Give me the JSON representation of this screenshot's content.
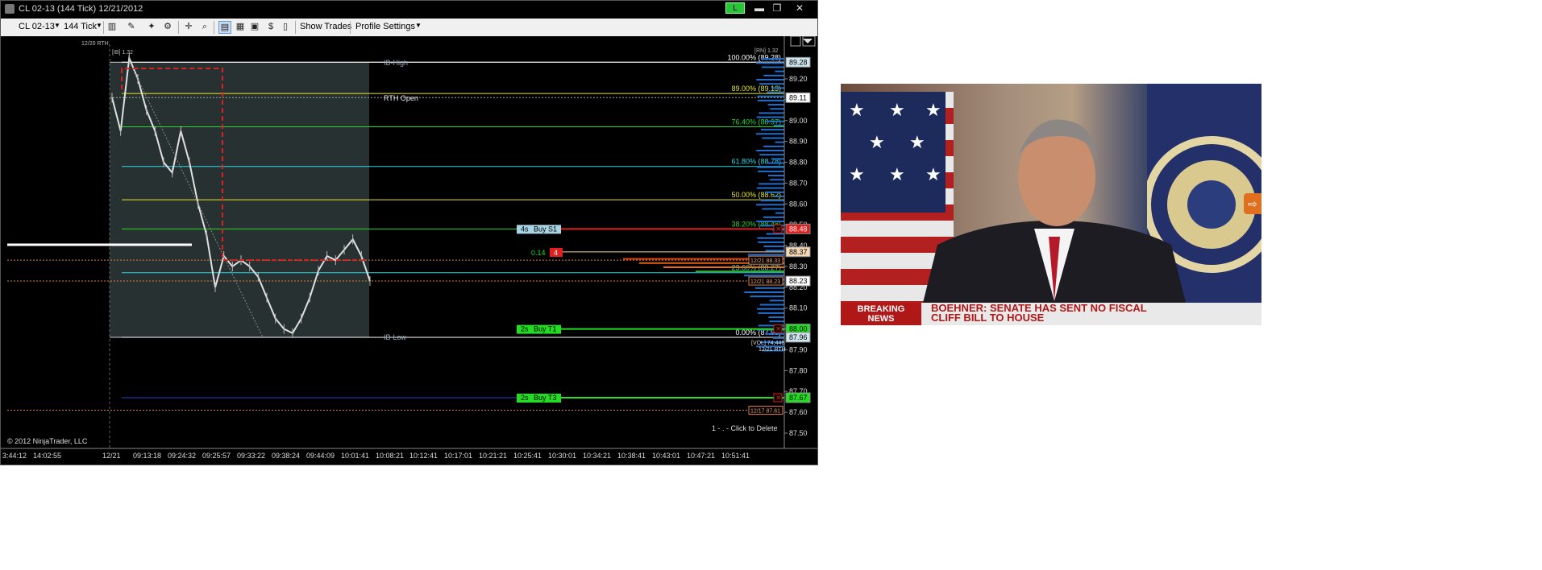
{
  "window": {
    "title": "CL 02-13 (144 Tick)  12/21/2012",
    "connection_badge": "L",
    "min_label": "▬",
    "max_label": "❐",
    "close_label": "✕"
  },
  "toolbar": {
    "instrument": "CL 02-13",
    "interval": "144 Tick",
    "show_trades": "Show Trades",
    "profile_settings": "Profile Settings"
  },
  "chart": {
    "header_label": "12/20 RTH",
    "ib_label": "[IB] 1.32",
    "right_top_label": "[RN] 1.32",
    "copyright": "© 2012 NinjaTrader, LLC",
    "delete_hint": "1 - . - Click to Delete",
    "vol_label": "[VOL] 74,446",
    "vol_sub": "12/21 RTH",
    "ib_high_label": "IB-High",
    "ib_low_label": "IB-Low",
    "rth_open_label": "RTH Open",
    "order_pnl": "0.14",
    "order_qty": "4",
    "colors": {
      "background": "#000000",
      "price_bar": "#e0e0e0",
      "ib_box": "#2f3a3a",
      "accent_red": "#e02020",
      "buy_green": "#22dd22"
    }
  },
  "chart_data": {
    "type": "line",
    "title": "CL 02-13 (144 Tick) 12/21/2012",
    "x_ticks": [
      "3:44:12",
      "14:02:55",
      "12/21",
      "09:13:18",
      "09:24:32",
      "09:25:57",
      "09:33:22",
      "09:38:24",
      "09:44:09",
      "10:01:41",
      "10:08:21",
      "10:12:41",
      "10:17:01",
      "10:21:21",
      "10:25:41",
      "10:30:01",
      "10:34:21",
      "10:38:41",
      "10:43:01",
      "10:47:21",
      "10:51:41"
    ],
    "y_ticks": [
      "89.20",
      "89.10",
      "89.00",
      "88.90",
      "88.80",
      "88.70",
      "88.60",
      "88.50",
      "88.40",
      "88.30",
      "88.20",
      "88.10",
      "88.00",
      "87.90",
      "87.80",
      "87.70",
      "87.60",
      "87.50"
    ],
    "ylim": [
      87.45,
      89.35
    ],
    "fib_levels": [
      {
        "label": "100.00% (89.28)",
        "price": 89.28,
        "color": "#ffffff"
      },
      {
        "label": "89.00% (89.13)",
        "price": 89.13,
        "color": "#e6e62a"
      },
      {
        "label": "76.40% (88.97)",
        "price": 88.97,
        "color": "#2ad82a"
      },
      {
        "label": "61.80% (88.78)",
        "price": 88.78,
        "color": "#2ad8e6"
      },
      {
        "label": "50.00% (88.62)",
        "price": 88.62,
        "color": "#e6e62a"
      },
      {
        "label": "38.20% (88.48)",
        "price": 88.48,
        "color": "#2ad82a"
      },
      {
        "label": "23.60% (88.27)",
        "price": 88.27,
        "color": "#2ad8e6"
      },
      {
        "label": "0.00% (87.96)",
        "price": 87.96,
        "color": "#ffffff"
      }
    ],
    "price_tags": [
      {
        "label": "89.28",
        "price": 89.28,
        "bg": "#cfe6ee",
        "fg": "#000000"
      },
      {
        "label": "89.11",
        "price": 89.11,
        "bg": "#ffffff",
        "fg": "#000000"
      },
      {
        "label": "88.48",
        "price": 88.48,
        "bg": "#e02020",
        "fg": "#ffffff"
      },
      {
        "label": "88.37",
        "price": 88.37,
        "bg": "#f3d7b6",
        "fg": "#000000"
      },
      {
        "label": "88.23",
        "price": 88.23,
        "bg": "#ffffff",
        "fg": "#000000"
      },
      {
        "label": "88.00",
        "price": 88.0,
        "bg": "#22dd22",
        "fg": "#000000"
      },
      {
        "label": "87.96",
        "price": 87.96,
        "bg": "#cfe6ee",
        "fg": "#000000"
      },
      {
        "label": "87.67",
        "price": 87.67,
        "bg": "#22dd22",
        "fg": "#000000"
      }
    ],
    "date_tags": [
      {
        "label": "12/21 88.33",
        "price": 88.33
      },
      {
        "label": "12/21 88.23",
        "price": 88.23
      },
      {
        "label": "12/17 87.61",
        "price": 87.61
      }
    ],
    "orders": [
      {
        "label": "Buy S1",
        "tif": "4s",
        "price": 88.48,
        "kind": "stop"
      },
      {
        "label": "Buy T1",
        "tif": "2s",
        "price": 88.0,
        "kind": "target"
      },
      {
        "label": "Buy T3",
        "tif": "2s",
        "price": 87.67,
        "kind": "target"
      }
    ],
    "ib_high": 89.28,
    "ib_low": 87.96,
    "rth_open": 89.11,
    "series": [
      {
        "values": [
          89.11,
          88.95,
          89.3,
          89.2,
          89.05,
          88.95,
          88.8,
          88.75,
          88.95,
          88.8,
          88.6,
          88.45,
          88.2,
          88.35,
          88.3,
          88.33,
          88.3,
          88.25,
          88.15,
          88.05,
          88.0,
          87.98,
          88.05,
          88.15,
          88.28,
          88.35,
          88.33,
          88.38,
          88.43,
          88.35,
          88.23
        ]
      }
    ]
  },
  "news": {
    "breaking_line1": "BREAKING",
    "breaking_line2": "NEWS",
    "headline_line1": "BOEHNER: SENATE HAS SENT NO FISCAL",
    "headline_line2": "CLIFF BILL TO HOUSE"
  }
}
